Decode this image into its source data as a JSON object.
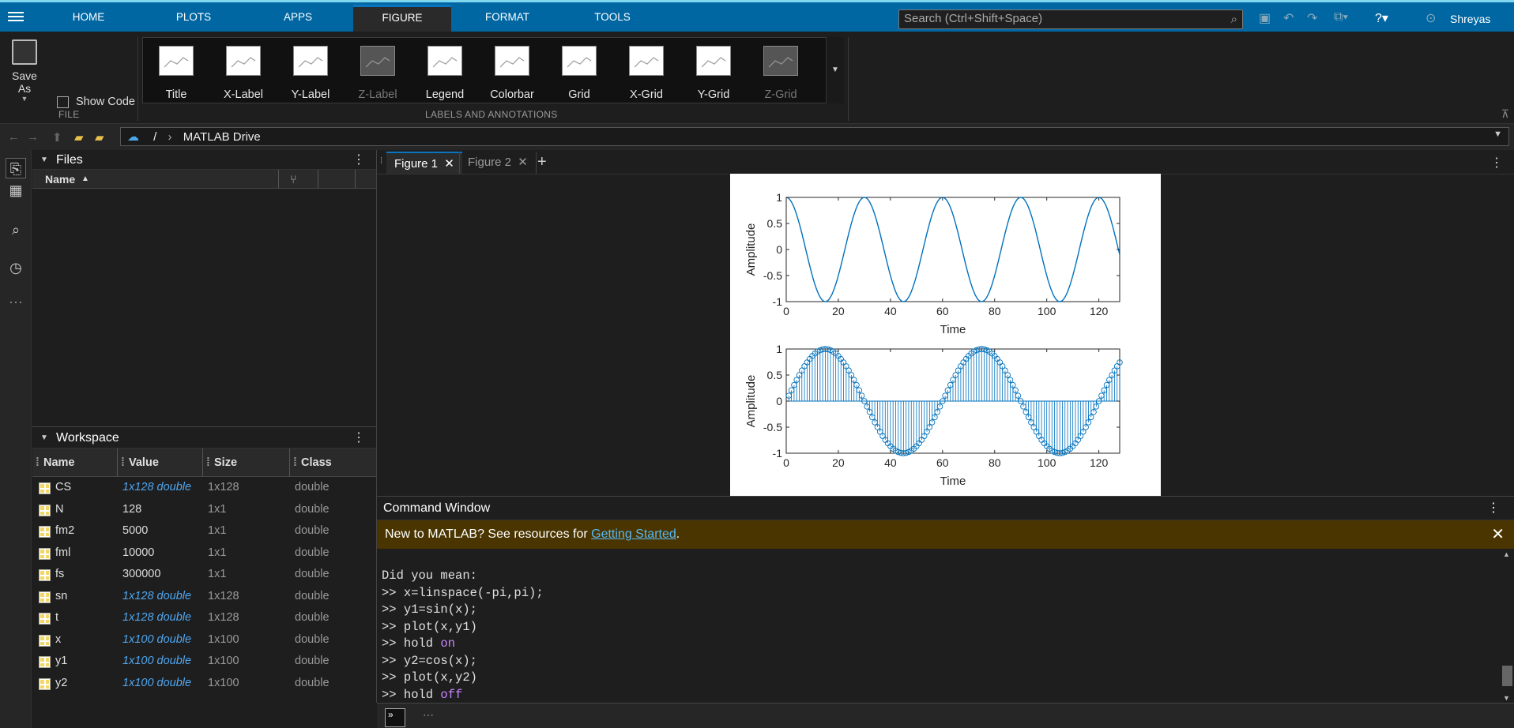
{
  "topbar": {
    "tabs": [
      "HOME",
      "PLOTS",
      "APPS",
      "FIGURE",
      "FORMAT",
      "TOOLS"
    ],
    "active_tab": "FIGURE",
    "search_placeholder": "Search (Ctrl+Shift+Space)",
    "user": "Shreyas"
  },
  "ribbon": {
    "save_as": "Save As",
    "show_code": "Show Code",
    "file_section": "FILE",
    "labels_section": "LABELS AND ANNOTATIONS",
    "gallery": [
      {
        "label": "Title",
        "enabled": true
      },
      {
        "label": "X-Label",
        "enabled": true
      },
      {
        "label": "Y-Label",
        "enabled": true
      },
      {
        "label": "Z-Label",
        "enabled": false
      },
      {
        "label": "Legend",
        "enabled": true
      },
      {
        "label": "Colorbar",
        "enabled": true
      },
      {
        "label": "Grid",
        "enabled": true
      },
      {
        "label": "X-Grid",
        "enabled": true
      },
      {
        "label": "Y-Grid",
        "enabled": true
      },
      {
        "label": "Z-Grid",
        "enabled": false
      }
    ]
  },
  "address": {
    "root": "/",
    "path": "MATLAB Drive"
  },
  "files_panel": {
    "title": "Files",
    "col_name": "Name"
  },
  "workspace": {
    "title": "Workspace",
    "columns": [
      "Name",
      "Value",
      "Size",
      "Class"
    ],
    "rows": [
      {
        "name": "CS",
        "value": "1x128 double",
        "size": "1x128",
        "class": "double",
        "link": true
      },
      {
        "name": "N",
        "value": "128",
        "size": "1x1",
        "class": "double",
        "link": false
      },
      {
        "name": "fm2",
        "value": "5000",
        "size": "1x1",
        "class": "double",
        "link": false
      },
      {
        "name": "fml",
        "value": "10000",
        "size": "1x1",
        "class": "double",
        "link": false
      },
      {
        "name": "fs",
        "value": "300000",
        "size": "1x1",
        "class": "double",
        "link": false
      },
      {
        "name": "sn",
        "value": "1x128 double",
        "size": "1x128",
        "class": "double",
        "link": true
      },
      {
        "name": "t",
        "value": "1x128 double",
        "size": "1x128",
        "class": "double",
        "link": true
      },
      {
        "name": "x",
        "value": "1x100 double",
        "size": "1x100",
        "class": "double",
        "link": true
      },
      {
        "name": "y1",
        "value": "1x100 double",
        "size": "1x100",
        "class": "double",
        "link": true
      },
      {
        "name": "y2",
        "value": "1x100 double",
        "size": "1x100",
        "class": "double",
        "link": true
      }
    ]
  },
  "figures": {
    "tabs": [
      "Figure 1",
      "Figure 2"
    ],
    "active": "Figure 1"
  },
  "chart_data": [
    {
      "type": "line",
      "xlabel": "Time",
      "ylabel": "Amplitude",
      "xlim": [
        0,
        128
      ],
      "ylim": [
        -1,
        1
      ],
      "xticks": [
        "0",
        "20",
        "40",
        "60",
        "80",
        "100",
        "120"
      ],
      "yticks": [
        "1",
        "0.5",
        "0",
        "-0.5",
        "-1"
      ],
      "series": [
        {
          "function": "cos",
          "period": 30,
          "color": "#0072bd"
        }
      ]
    },
    {
      "type": "stem",
      "xlabel": "Time",
      "ylabel": "Amplitude",
      "xlim": [
        0,
        128
      ],
      "ylim": [
        -1,
        1
      ],
      "xticks": [
        "0",
        "20",
        "40",
        "60",
        "80",
        "100",
        "120"
      ],
      "yticks": [
        "1",
        "0.5",
        "0",
        "-0.5",
        "-1"
      ],
      "series": [
        {
          "function": "sin",
          "period": 60,
          "color": "#0072bd"
        }
      ]
    }
  ],
  "command_window": {
    "title": "Command Window",
    "banner_text": "New to MATLAB? See resources for ",
    "banner_link": "Getting Started",
    "banner_end": ".",
    "lines": [
      {
        "prompt": "",
        "code": "Did you mean:",
        "kw": ""
      },
      {
        "prompt": ">> ",
        "code": "x=linspace(-pi,pi);",
        "kw": ""
      },
      {
        "prompt": ">> ",
        "code": "y1=sin(x);",
        "kw": ""
      },
      {
        "prompt": ">> ",
        "code": "plot(x,y1)",
        "kw": ""
      },
      {
        "prompt": ">> ",
        "code": "hold ",
        "kw": "on"
      },
      {
        "prompt": ">> ",
        "code": "y2=cos(x);",
        "kw": ""
      },
      {
        "prompt": ">> ",
        "code": "plot(x,y2)",
        "kw": ""
      },
      {
        "prompt": ">> ",
        "code": "hold ",
        "kw": "off"
      }
    ]
  }
}
